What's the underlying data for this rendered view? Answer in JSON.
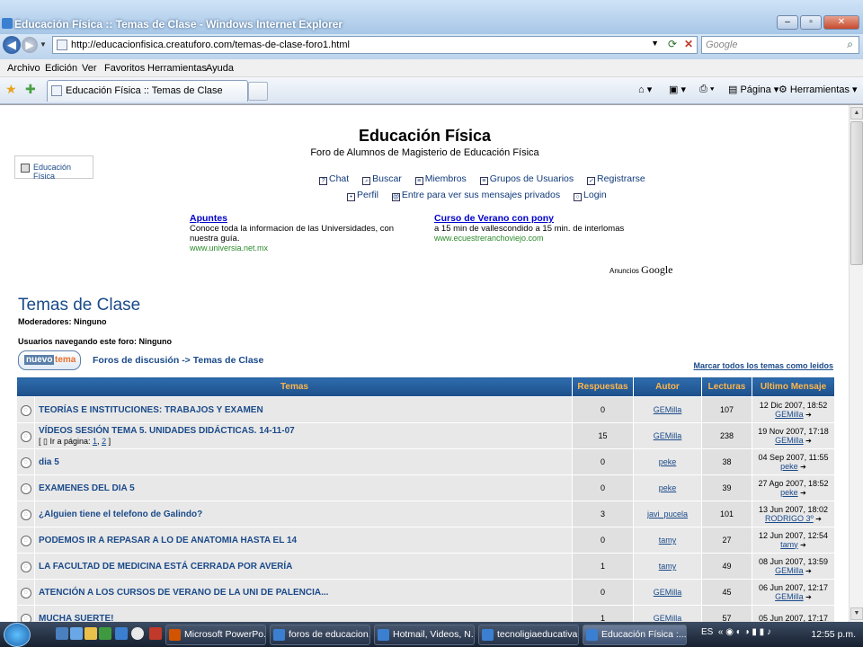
{
  "window": {
    "title": "Educación Física :: Temas de Clase - Windows Internet Explorer",
    "url": "http://educacionfisica.creatuforo.com/temas-de-clase-foro1.html",
    "search_placeholder": "Google"
  },
  "menu": [
    "Archivo",
    "Edición",
    "Ver",
    "Favoritos",
    "Herramientas",
    "Ayuda"
  ],
  "tab": {
    "label": "Educación Física :: Temas de Clase"
  },
  "command_bar": {
    "page_label": "Página",
    "tools_label": "Herramientas"
  },
  "site": {
    "logo_text": "Educación Física",
    "title": "Educación Física",
    "subtitle": "Foro de Alumnos de Magisterio de Educación Física",
    "nav1": [
      "Chat",
      "Buscar",
      "Miembros",
      "Grupos de Usuarios",
      "Registrarse"
    ],
    "nav2": [
      "Perfil",
      "Entre para ver sus mensajes privados",
      "Login"
    ]
  },
  "ads": [
    {
      "title": "Apuntes",
      "text": "Conoce toda la informacion de las Universidades, con nuestra guía.",
      "url": "www.universia.net.mx"
    },
    {
      "title": "Curso de Verano con pony",
      "text": "a 15 min de vallescondido a 15 min. de interlomas",
      "url": "www.ecuestreranchoviejo.com"
    }
  ],
  "ads_by": {
    "prefix": "Anuncios",
    "brand": "Google"
  },
  "forum": {
    "title": "Temas de Clase",
    "moderators": "Moderadores: Ninguno",
    "users": "Usuarios navegando este foro: Ninguno",
    "new_topic_a": "nuevo",
    "new_topic_b": "tema",
    "crumb_home": "Foros de discusión",
    "crumb_sep": "->",
    "crumb_current": "Temas de Clase",
    "mark_read": "Marcar todos los temas como leidos"
  },
  "table": {
    "headers": [
      "Temas",
      "Respuestas",
      "Autor",
      "Lecturas",
      "Ultimo Mensaje"
    ],
    "goto_label": "Ir a página:",
    "rows": [
      {
        "topic": "TEORÍAS E INSTITUCIONES: TRABAJOS Y EXAMEN",
        "replies": "0",
        "author": "GEMilla",
        "reads": "107",
        "last_date": "12 Dic 2007, 18:52",
        "last_user": "GEMilla"
      },
      {
        "topic": "VÍDEOS SESIÓN TEMA 5. UNIDADES DIDÁCTICAS. 14-11-07",
        "replies": "15",
        "author": "GEMilla",
        "reads": "238",
        "last_date": "19 Nov 2007, 17:18",
        "last_user": "GEMilla",
        "pages": [
          "1",
          "2"
        ]
      },
      {
        "topic": "dia 5",
        "replies": "0",
        "author": "peke",
        "reads": "38",
        "last_date": "04 Sep 2007, 11:55",
        "last_user": "peke"
      },
      {
        "topic": "EXAMENES DEL DIA 5",
        "replies": "0",
        "author": "peke",
        "reads": "39",
        "last_date": "27 Ago 2007, 18:52",
        "last_user": "peke"
      },
      {
        "topic": "¿Alguien tiene el telefono de Galindo?",
        "replies": "3",
        "author": "javi_pucela",
        "reads": "101",
        "last_date": "13 Jun 2007, 18:02",
        "last_user": "RODRIGO 3º"
      },
      {
        "topic": "PODEMOS IR A REPASAR A LO DE ANATOMIA HASTA EL 14",
        "replies": "0",
        "author": "tamy",
        "reads": "27",
        "last_date": "12 Jun 2007, 12:54",
        "last_user": "tamy"
      },
      {
        "topic": "LA FACULTAD DE MEDICINA ESTÁ CERRADA POR AVERÍA",
        "replies": "1",
        "author": "tamy",
        "reads": "49",
        "last_date": "08 Jun 2007, 13:59",
        "last_user": "GEMilla"
      },
      {
        "topic": "ATENCIÓN A LOS CURSOS DE VERANO DE LA UNI DE PALENCIA...",
        "replies": "0",
        "author": "GEMilla",
        "reads": "45",
        "last_date": "06 Jun 2007, 12:17",
        "last_user": "GEMilla"
      },
      {
        "topic": "MUCHA SUERTE!",
        "replies": "1",
        "author": "GEMilla",
        "reads": "57",
        "last_date": "05 Jun 2007, 17:17",
        "last_user": ""
      }
    ]
  },
  "taskbar": {
    "tasks": [
      "Microsoft PowerPo...",
      "foros de educacion...",
      "Hotmail, Videos, N...",
      "tecnoligiaeducativa...",
      "Educación Física :..."
    ],
    "lang": "ES",
    "clock": "12:55 p.m."
  }
}
